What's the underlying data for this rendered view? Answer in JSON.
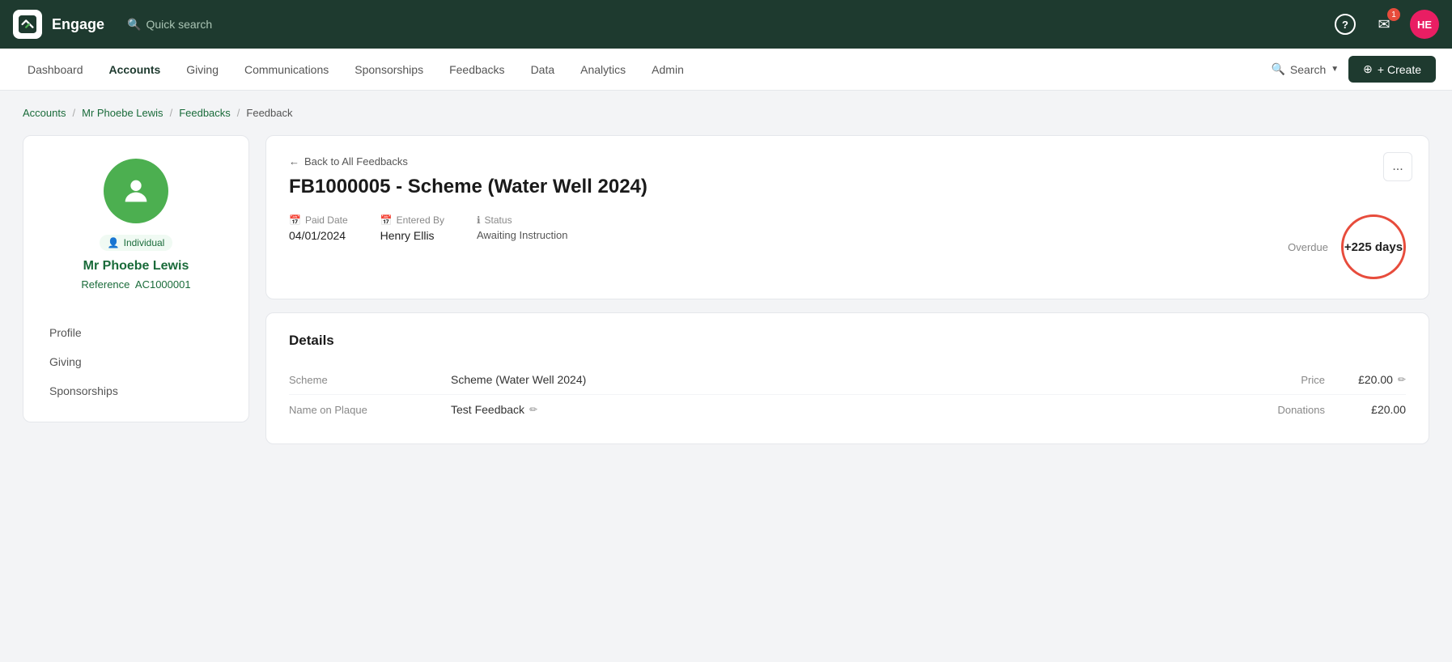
{
  "app": {
    "brand": "Engage",
    "logo_alt": "engage-logo",
    "avatar_initials": "HE",
    "quick_search_label": "Quick search",
    "notification_count": "1"
  },
  "mainnav": {
    "items": [
      {
        "id": "dashboard",
        "label": "Dashboard",
        "active": false
      },
      {
        "id": "accounts",
        "label": "Accounts",
        "active": true
      },
      {
        "id": "giving",
        "label": "Giving",
        "active": false
      },
      {
        "id": "communications",
        "label": "Communications",
        "active": false
      },
      {
        "id": "sponsorships",
        "label": "Sponsorships",
        "active": false
      },
      {
        "id": "feedbacks",
        "label": "Feedbacks",
        "active": false
      },
      {
        "id": "data",
        "label": "Data",
        "active": false
      },
      {
        "id": "analytics",
        "label": "Analytics",
        "active": false
      },
      {
        "id": "admin",
        "label": "Admin",
        "active": false
      }
    ],
    "search_label": "Search",
    "create_label": "+ Create"
  },
  "breadcrumb": {
    "items": [
      {
        "label": "Accounts",
        "href": "#"
      },
      {
        "label": "Mr Phoebe Lewis",
        "href": "#"
      },
      {
        "label": "Feedbacks",
        "href": "#"
      },
      {
        "label": "Feedback",
        "href": null
      }
    ]
  },
  "left_panel": {
    "individual_badge": "Individual",
    "name": "Mr Phoebe Lewis",
    "reference_label": "Reference",
    "reference": "AC1000001",
    "nav_items": [
      {
        "label": "Profile"
      },
      {
        "label": "Giving"
      },
      {
        "label": "Sponsorships"
      }
    ]
  },
  "feedback_detail": {
    "back_label": "Back to All Feedbacks",
    "title": "FB1000005 - Scheme (Water Well 2024)",
    "paid_date_label": "Paid Date",
    "paid_date": "04/01/2024",
    "entered_by_label": "Entered By",
    "entered_by": "Henry Ellis",
    "status_label": "Status",
    "status_value": "Awaiting Instruction",
    "overdue_label": "Overdue",
    "overdue_days": "+225 days",
    "more_btn_label": "..."
  },
  "details_section": {
    "title": "Details",
    "rows": [
      {
        "key": "Scheme",
        "value": "Scheme (Water Well 2024)",
        "right_key": "Price",
        "right_value": "£20.00",
        "right_editable": true
      },
      {
        "key": "Name on Plaque",
        "value": "Test Feedback",
        "value_editable": true,
        "right_key": "Donations",
        "right_value": "£20.00",
        "right_editable": false
      }
    ]
  },
  "icons": {
    "search": "🔍",
    "help": "?",
    "notification": "✉",
    "back_arrow": "←",
    "calendar": "📅",
    "info": "ℹ",
    "user": "👤",
    "edit": "✏",
    "plus": "+"
  }
}
